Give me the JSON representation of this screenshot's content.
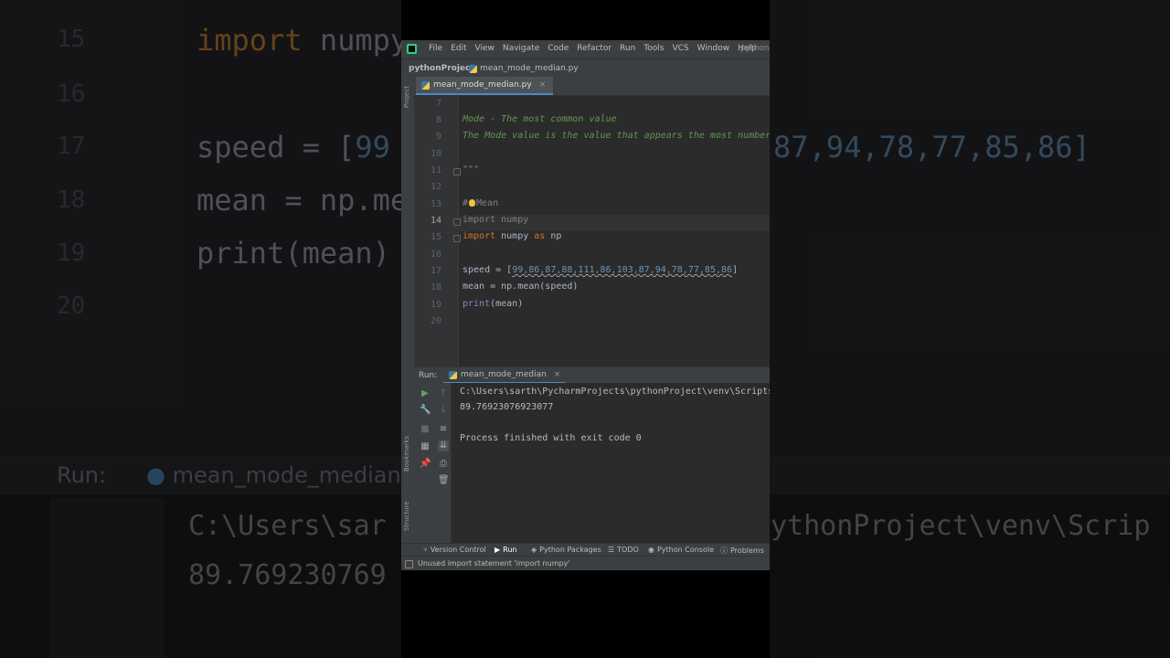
{
  "menubar": {
    "items": [
      "File",
      "Edit",
      "View",
      "Navigate",
      "Code",
      "Refactor",
      "Run",
      "Tools",
      "VCS",
      "Window",
      "Help"
    ],
    "project_title": "pythonP"
  },
  "breadcrumb": {
    "project": "pythonProject",
    "file": "mean_mode_median.py"
  },
  "side_labels": {
    "project": "Project",
    "bookmarks": "Bookmarks",
    "structure": "Structure"
  },
  "editor": {
    "tab_label": "mean_mode_median.py",
    "line_numbers": [
      "7",
      "8",
      "9",
      "10",
      "11",
      "12",
      "13",
      "14",
      "15",
      "16",
      "17",
      "18",
      "19",
      "20"
    ],
    "current_line": "14",
    "lines": {
      "l8": "Mode - The most common value",
      "l9": "The Mode value is the value that appears the most number of times",
      "l11": "\"\"\"",
      "l13_hash": "#",
      "l13_text": "Mean",
      "l14_kw": "import",
      "l14_mod": " numpy",
      "l15_kw": "import",
      "l15_mod": " numpy",
      "l15_as": " as",
      "l15_alias": " np",
      "l17_prefix": "speed = [",
      "l17_nums": "99,86,87,88,111,86,103,87,94,78,77,85,86",
      "l17_suffix": "]",
      "l18": "mean = np.mean(speed)",
      "l19_fn": "print",
      "l19_rest": "(mean)"
    }
  },
  "run_panel": {
    "label": "Run:",
    "tab_label": "mean_mode_median",
    "output": [
      "C:\\Users\\sarth\\PycharmProjects\\pythonProject\\venv\\Scripts\\python.exe",
      "89.76923076923077",
      "",
      "Process finished with exit code 0"
    ]
  },
  "tool_windows": [
    "Version Control",
    "Run",
    "Python Packages",
    "TODO",
    "Python Console",
    "Problems"
  ],
  "status_bar": {
    "message": "Unused import statement 'import numpy'"
  },
  "background_zoom": {
    "line_numbers": [
      "15",
      "16",
      "17",
      "18",
      "19",
      "20"
    ],
    "code": {
      "import_kw": "import",
      "import_mod": " numpy",
      "speed_prefix": "speed = [",
      "speed_nums_left": "99",
      "speed_nums_right": "87,94,78,77,85,86]",
      "mean_line": "mean = np.me",
      "print_line": "print(mean)"
    },
    "run_label": "Run:",
    "run_tab": "mean_mode_median",
    "console_path_left": "C:\\Users\\sar",
    "console_path_right": "ythonProject\\venv\\Scrip",
    "console_value": "89.769230769"
  },
  "colors": {
    "editor_bg": "#2b2b2b",
    "panel_bg": "#3c3f41",
    "keyword": "#cc7832",
    "number": "#6897bb",
    "docstring": "#629755",
    "accent": "#4a88c7"
  }
}
